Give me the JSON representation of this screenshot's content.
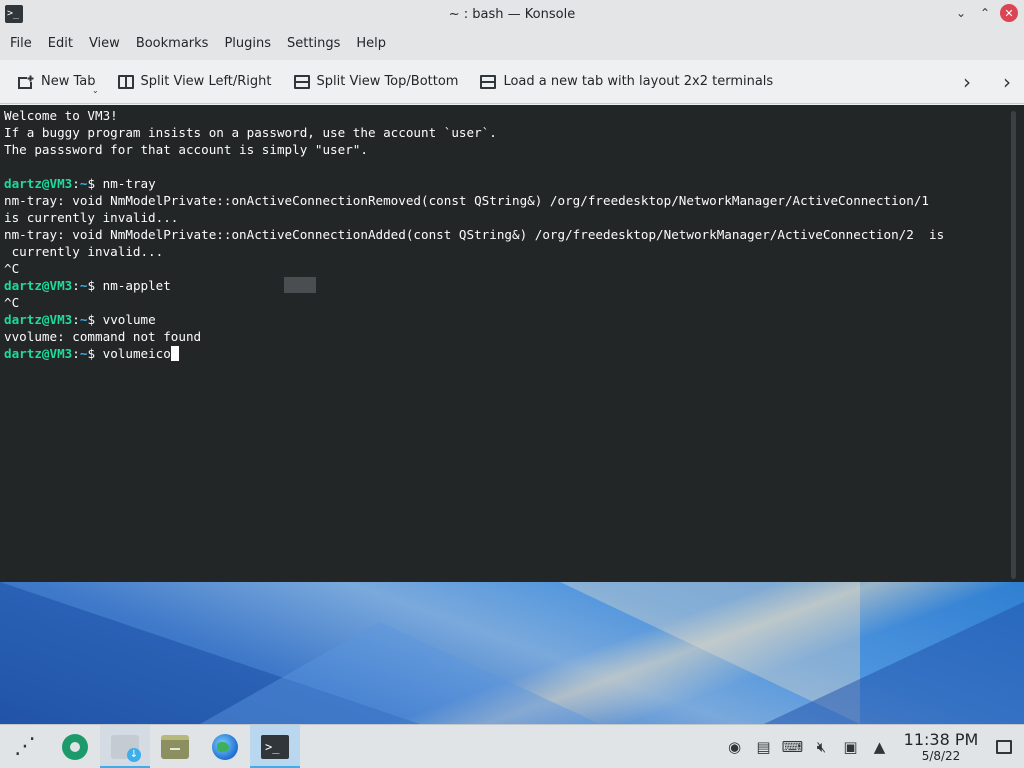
{
  "window": {
    "title": "~ : bash — Konsole",
    "controls": {
      "minimize": "⌄",
      "maximize": "⌃",
      "close": "✕"
    }
  },
  "menubar": {
    "items": [
      "File",
      "Edit",
      "View",
      "Bookmarks",
      "Plugins",
      "Settings",
      "Help"
    ]
  },
  "toolbar": {
    "new_tab": "New Tab",
    "split_lr": "Split View Left/Right",
    "split_tb": "Split View Top/Bottom",
    "load_layout": "Load a new tab with layout 2x2 terminals"
  },
  "terminal": {
    "lines": [
      {
        "type": "text",
        "text": "Welcome to VM3!"
      },
      {
        "type": "text",
        "text": "If a buggy program insists on a password, use the account `user`."
      },
      {
        "type": "text",
        "text": "The passsword for that account is simply \"user\"."
      },
      {
        "type": "text",
        "text": ""
      },
      {
        "type": "prompt",
        "user": "dartz@VM3",
        "path": "~",
        "cmd": "nm-tray"
      },
      {
        "type": "text",
        "text": "nm-tray: void NmModelPrivate::onActiveConnectionRemoved(const QString&) /org/freedesktop/NetworkManager/ActiveConnection/1"
      },
      {
        "type": "text",
        "text": "is currently invalid..."
      },
      {
        "type": "text",
        "text": "nm-tray: void NmModelPrivate::onActiveConnectionAdded(const QString&) /org/freedesktop/NetworkManager/ActiveConnection/2  is"
      },
      {
        "type": "text",
        "text": " currently invalid..."
      },
      {
        "type": "text",
        "text": "^C"
      },
      {
        "type": "prompt",
        "user": "dartz@VM3",
        "path": "~",
        "cmd": "nm-applet"
      },
      {
        "type": "text",
        "text": "^C"
      },
      {
        "type": "prompt",
        "user": "dartz@VM3",
        "path": "~",
        "cmd": "vvolume"
      },
      {
        "type": "text",
        "text": "vvolume: command not found"
      },
      {
        "type": "prompt",
        "user": "dartz@VM3",
        "path": "~",
        "cmd": "volumeico",
        "cursor": true
      }
    ]
  },
  "taskbar": {
    "apps": [
      {
        "name": "application-launcher-icon",
        "state": "normal"
      },
      {
        "name": "system-settings-icon",
        "state": "normal"
      },
      {
        "name": "discover-icon",
        "state": "running"
      },
      {
        "name": "file-manager-icon",
        "state": "normal"
      },
      {
        "name": "web-browser-icon",
        "state": "normal"
      },
      {
        "name": "konsole-icon",
        "state": "active"
      }
    ],
    "clock": {
      "time": "11:38 PM",
      "date": "5/8/22"
    }
  }
}
